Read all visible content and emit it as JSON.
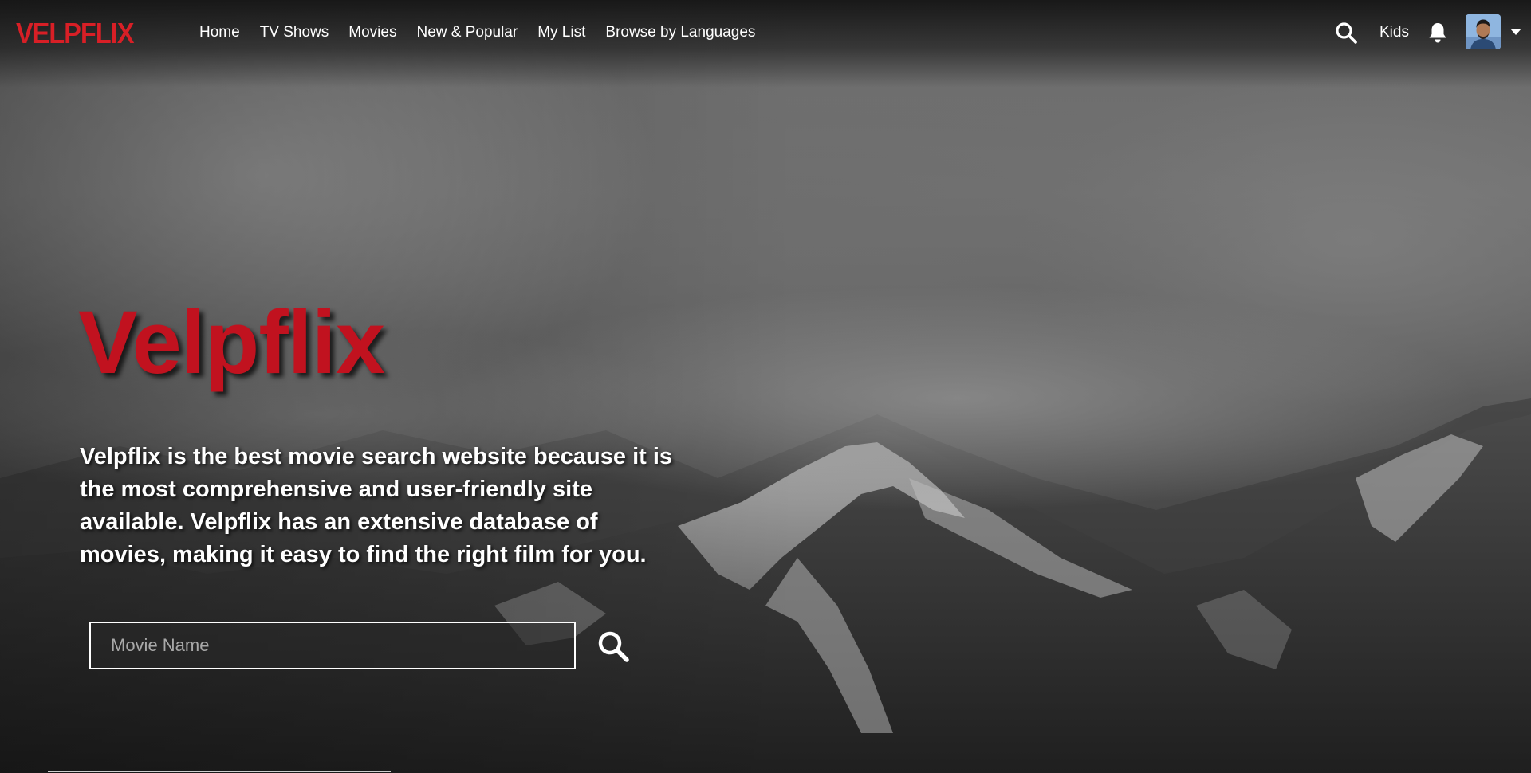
{
  "brand": {
    "logo_text": "VELPFLIX",
    "accent_color": "#d81f26"
  },
  "nav": {
    "links": [
      {
        "label": "Home"
      },
      {
        "label": "TV Shows"
      },
      {
        "label": "Movies"
      },
      {
        "label": "New & Popular"
      },
      {
        "label": "My List"
      },
      {
        "label": "Browse by Languages"
      }
    ],
    "search_icon": "search-icon",
    "kids_label": "Kids",
    "bell_icon": "bell-icon",
    "avatar_icon": "user-avatar",
    "caret_icon": "caret-down-icon"
  },
  "hero": {
    "title": "Velpflix",
    "description": "Velpflix is the best movie search website because it is the most comprehensive and user-friendly site available. Velpflix has an extensive database of movies, making it easy to find the right film for you.",
    "search_placeholder": "Movie Name",
    "search_value": "",
    "search_button_icon": "search-icon"
  }
}
